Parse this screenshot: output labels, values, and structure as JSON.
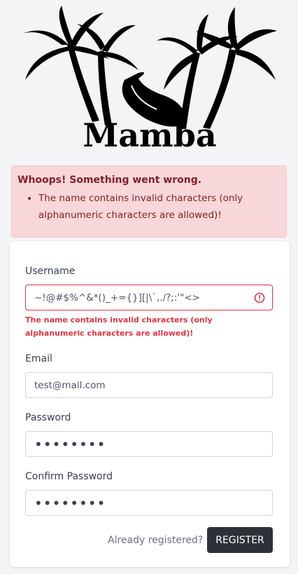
{
  "logo": {
    "text": "Mamba"
  },
  "alert": {
    "title": "Whoops! Something went wrong.",
    "errors": [
      "The name contains invalid characters (only alphanumeric characters are allowed)!"
    ]
  },
  "form": {
    "username": {
      "label": "Username",
      "value": "~!@#$%^&*()_+={}][|\\`,./?;:'\"<>",
      "error": "The name contains invalid characters (only alphanumeric characters are allowed)!"
    },
    "email": {
      "label": "Email",
      "value": "test@mail.com"
    },
    "password": {
      "label": "Password",
      "value": "••••••••"
    },
    "confirm_password": {
      "label": "Confirm Password",
      "value": "••••••••"
    },
    "login_link": "Already registered?",
    "submit": "REGISTER"
  },
  "colors": {
    "error": "#dc3545",
    "alert_bg": "#f8d7da",
    "button_bg": "#2d3238"
  }
}
